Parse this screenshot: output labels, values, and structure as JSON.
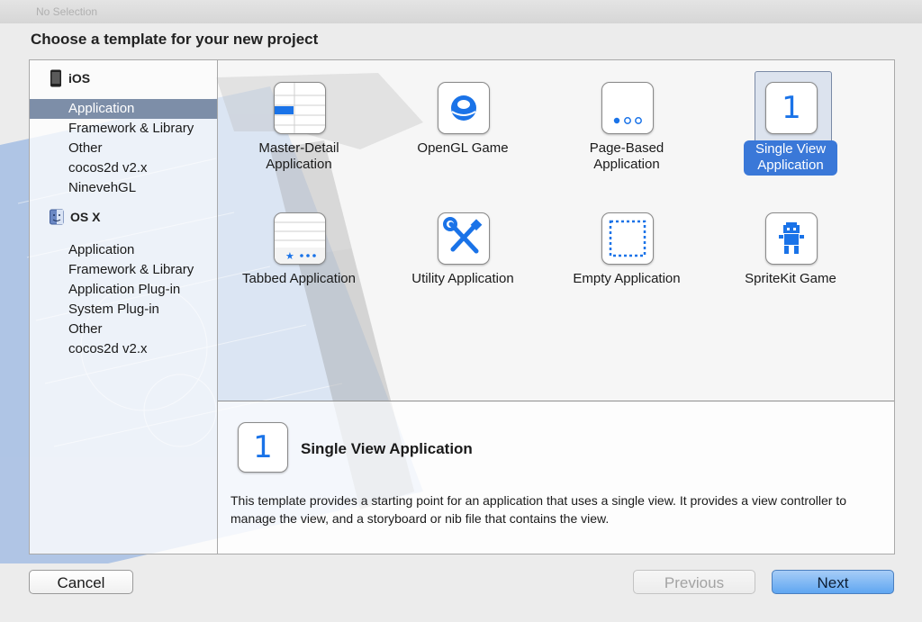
{
  "window": {
    "nav_ghost": "No Selection"
  },
  "dialog": {
    "heading": "Choose a template for your new project"
  },
  "sidebar": {
    "sections": [
      {
        "title": "iOS",
        "icon": "iphone-icon",
        "items": [
          "Application",
          "Framework & Library",
          "Other",
          "cocos2d v2.x",
          "NinevehGL"
        ]
      },
      {
        "title": "OS X",
        "icon": "finder-icon",
        "items": [
          "Application",
          "Framework & Library",
          "Application Plug-in",
          "System Plug-in",
          "Other",
          "cocos2d v2.x"
        ]
      }
    ],
    "selected": "iOS / Application"
  },
  "templates": [
    {
      "label": "Master-Detail\nApplication",
      "icon": "master-detail-icon"
    },
    {
      "label": "OpenGL Game",
      "icon": "opengl-icon"
    },
    {
      "label": "Page-Based\nApplication",
      "icon": "page-based-icon"
    },
    {
      "label": "Single View\nApplication",
      "icon": "single-view-icon",
      "selected": true,
      "glyph": "1"
    },
    {
      "label": "Tabbed Application",
      "icon": "tabbed-icon"
    },
    {
      "label": "Utility Application",
      "icon": "utility-icon"
    },
    {
      "label": "Empty Application",
      "icon": "empty-icon"
    },
    {
      "label": "SpriteKit Game",
      "icon": "spritekit-icon"
    }
  ],
  "detail": {
    "glyph": "1",
    "title": "Single View Application",
    "description": "This template provides a starting point for an application that uses a single view. It provides a view controller to manage the view, and a storyboard or nib file that contains the view."
  },
  "buttons": {
    "cancel": "Cancel",
    "previous": "Previous",
    "next": "Next"
  },
  "colors": {
    "accent": "#3a78d8",
    "icon_blue": "#1a73e8",
    "sidebar_selection": "#7d8ea8"
  }
}
